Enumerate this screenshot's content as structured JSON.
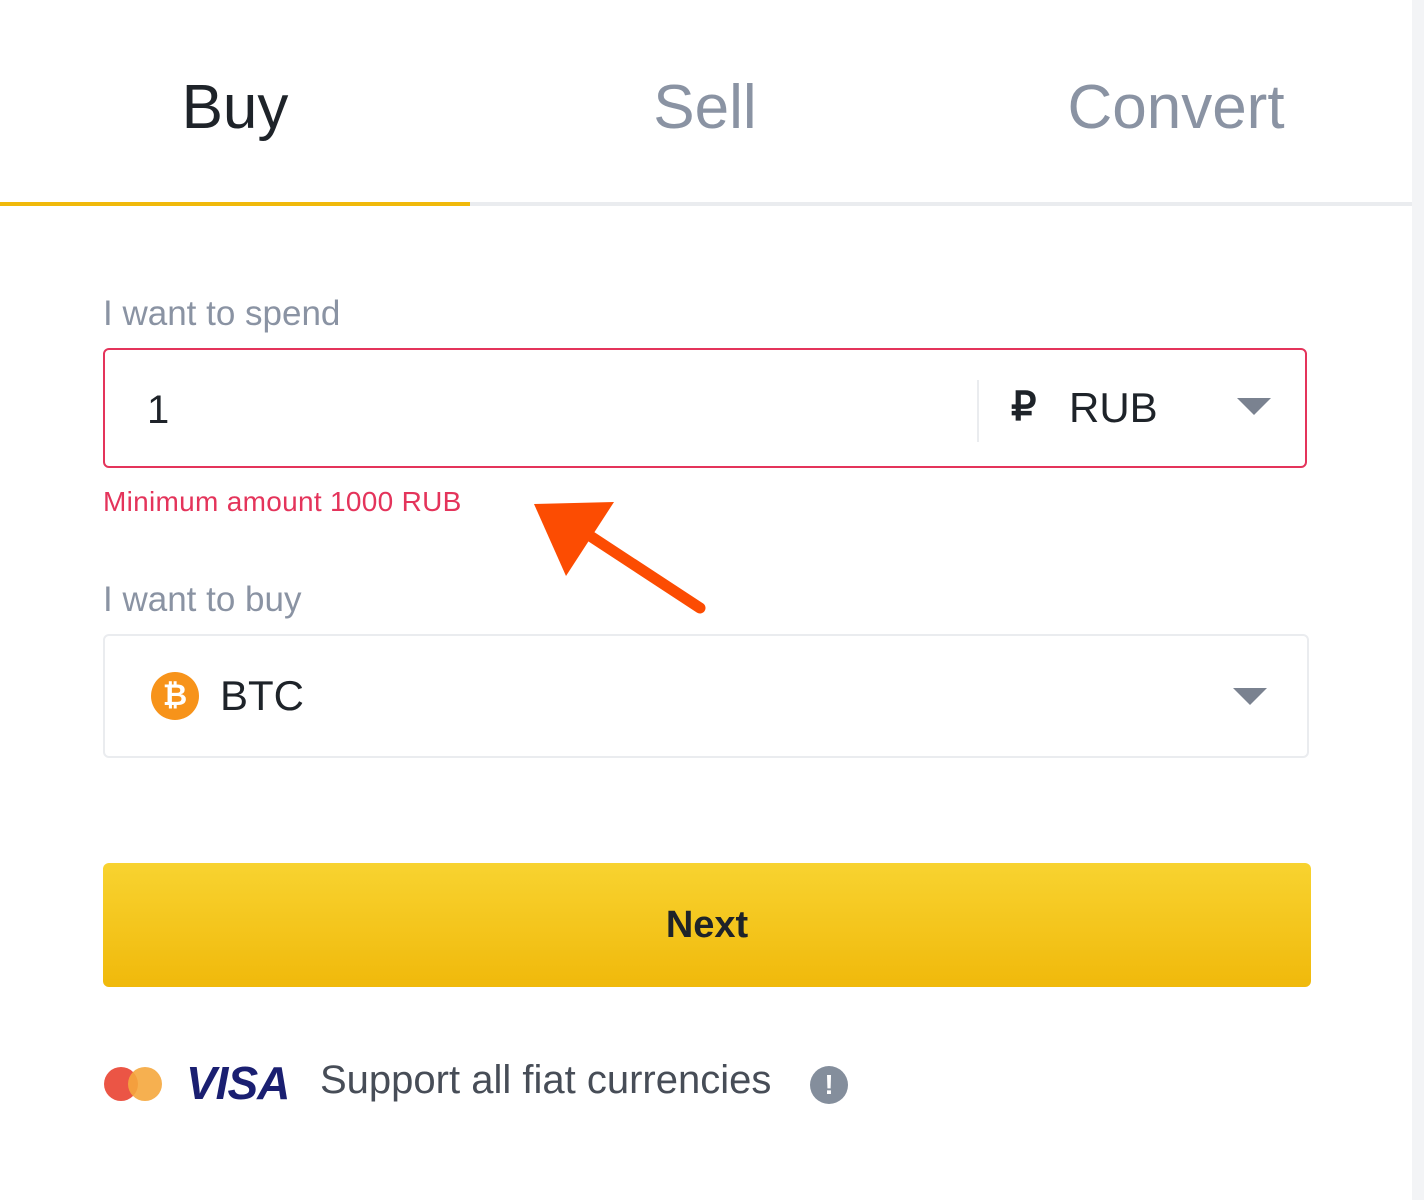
{
  "tabs": {
    "buy": "Buy",
    "sell": "Sell",
    "convert": "Convert",
    "active": "Buy"
  },
  "spend": {
    "label": "I want to spend",
    "value": "1",
    "currency_symbol": "₽",
    "currency": "RUB",
    "error": "Minimum amount 1000 RUB"
  },
  "buy": {
    "label": "I want to buy",
    "coin_icon": "bitcoin-icon",
    "coin": "BTC"
  },
  "next_label": "Next",
  "footer": {
    "visa": "VISA",
    "support_text": "Support all fiat currencies",
    "info_icon": "info-icon"
  },
  "colors": {
    "accent": "#f0b90b",
    "error": "#e4345b",
    "btc": "#f7931a",
    "annotation_arrow": "#fc4c02"
  }
}
